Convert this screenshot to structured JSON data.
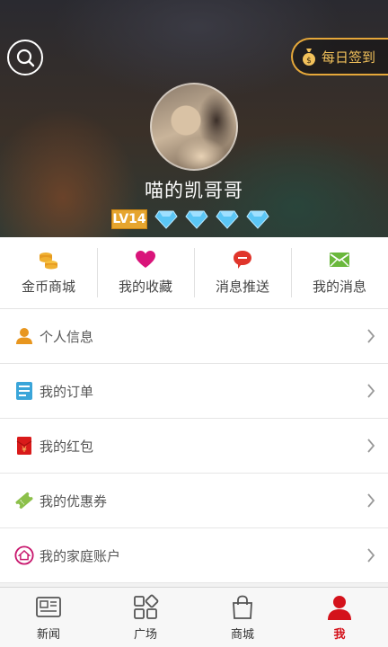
{
  "header": {
    "checkin_label": "每日签到",
    "username": "喵的凯哥哥",
    "level": "LV14",
    "diamonds": [
      "diamond-icon",
      "diamond-icon",
      "diamond-icon",
      "diamond-icon"
    ]
  },
  "quick_actions": [
    {
      "label": "金币商城",
      "icon": "coins-icon",
      "color": "#e6a030"
    },
    {
      "label": "我的收藏",
      "icon": "heart-icon",
      "color": "#d9147a"
    },
    {
      "label": "消息推送",
      "icon": "chat-bubble-icon",
      "color": "#e0352b"
    },
    {
      "label": "我的消息",
      "icon": "envelope-icon",
      "color": "#6ab83c"
    }
  ],
  "menu": [
    {
      "label": "个人信息",
      "icon": "person-icon"
    },
    {
      "label": "我的订单",
      "icon": "order-icon"
    },
    {
      "label": "我的红包",
      "icon": "red-envelope-icon"
    },
    {
      "label": "我的优惠券",
      "icon": "coupon-icon"
    },
    {
      "label": "我的家庭账户",
      "icon": "home-icon"
    }
  ],
  "tabs": [
    {
      "label": "新闻",
      "icon": "news-icon",
      "active": false
    },
    {
      "label": "广场",
      "icon": "grid-icon",
      "active": false
    },
    {
      "label": "商城",
      "icon": "shopping-bag-icon",
      "active": false
    },
    {
      "label": "我",
      "icon": "user-icon",
      "active": true
    }
  ],
  "colors": {
    "accent_red": "#d4121b",
    "gold": "#e6a83a"
  }
}
